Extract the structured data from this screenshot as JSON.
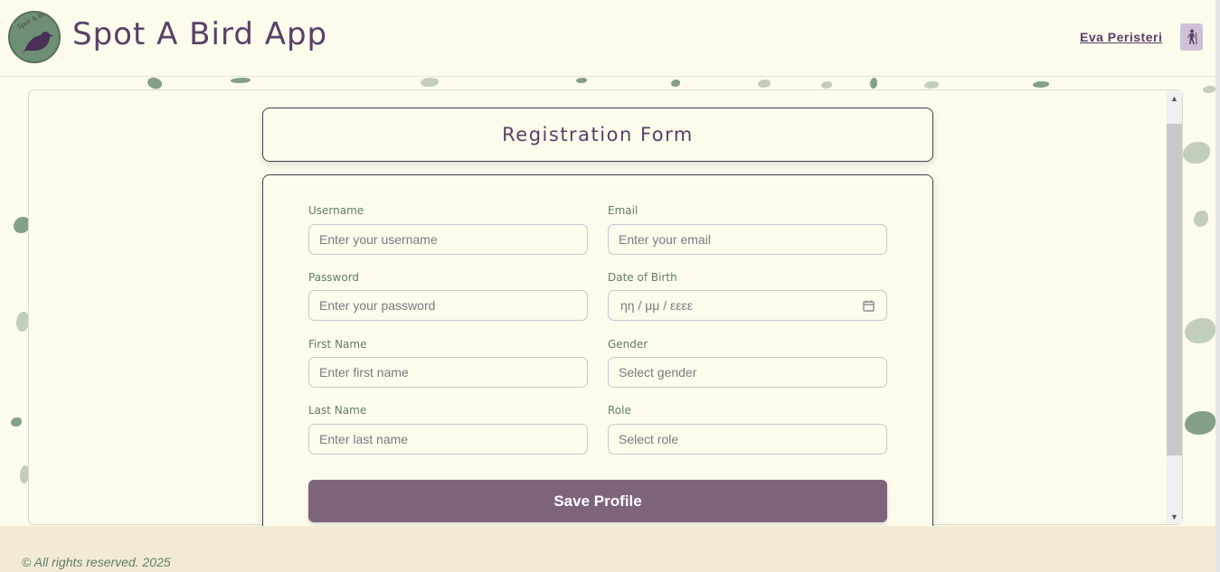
{
  "header": {
    "logo_text": "Spot A Bird",
    "app_title": "Spot A Bird App",
    "user_name": "Eva Peristeri",
    "user_icon": "hiker-icon"
  },
  "form": {
    "title": "Registration Form",
    "fields": {
      "username": {
        "label": "Username",
        "placeholder": "Enter your username"
      },
      "email": {
        "label": "Email",
        "placeholder": "Enter your email"
      },
      "password": {
        "label": "Password",
        "placeholder": "Enter your password"
      },
      "dob": {
        "label": "Date of Birth",
        "placeholder": "ηη / μμ / εεεε",
        "icon": "calendar-icon"
      },
      "first_name": {
        "label": "First Name",
        "placeholder": "Enter first name"
      },
      "gender": {
        "label": "Gender",
        "selected": "Select gender"
      },
      "last_name": {
        "label": "Last Name",
        "placeholder": "Enter last name"
      },
      "role": {
        "label": "Role",
        "selected": "Select role"
      }
    },
    "save_label": "Save Profile"
  },
  "footer": {
    "copyright": "© All rights reserved. 2025"
  },
  "colors": {
    "background": "#fdfbec",
    "brand_purple": "#5a3f66",
    "label_green": "#5f7d66",
    "button": "#7d647b",
    "footer_bg": "#f3ead6"
  }
}
